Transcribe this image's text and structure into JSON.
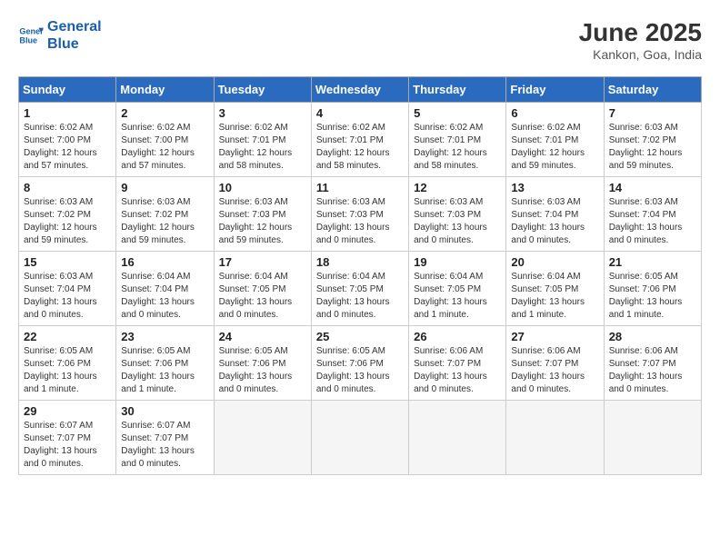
{
  "header": {
    "logo_line1": "General",
    "logo_line2": "Blue",
    "month": "June 2025",
    "location": "Kankon, Goa, India"
  },
  "days_of_week": [
    "Sunday",
    "Monday",
    "Tuesday",
    "Wednesday",
    "Thursday",
    "Friday",
    "Saturday"
  ],
  "weeks": [
    [
      {
        "day": "1",
        "info": "Sunrise: 6:02 AM\nSunset: 7:00 PM\nDaylight: 12 hours\nand 57 minutes."
      },
      {
        "day": "2",
        "info": "Sunrise: 6:02 AM\nSunset: 7:00 PM\nDaylight: 12 hours\nand 57 minutes."
      },
      {
        "day": "3",
        "info": "Sunrise: 6:02 AM\nSunset: 7:01 PM\nDaylight: 12 hours\nand 58 minutes."
      },
      {
        "day": "4",
        "info": "Sunrise: 6:02 AM\nSunset: 7:01 PM\nDaylight: 12 hours\nand 58 minutes."
      },
      {
        "day": "5",
        "info": "Sunrise: 6:02 AM\nSunset: 7:01 PM\nDaylight: 12 hours\nand 58 minutes."
      },
      {
        "day": "6",
        "info": "Sunrise: 6:02 AM\nSunset: 7:01 PM\nDaylight: 12 hours\nand 59 minutes."
      },
      {
        "day": "7",
        "info": "Sunrise: 6:03 AM\nSunset: 7:02 PM\nDaylight: 12 hours\nand 59 minutes."
      }
    ],
    [
      {
        "day": "8",
        "info": "Sunrise: 6:03 AM\nSunset: 7:02 PM\nDaylight: 12 hours\nand 59 minutes."
      },
      {
        "day": "9",
        "info": "Sunrise: 6:03 AM\nSunset: 7:02 PM\nDaylight: 12 hours\nand 59 minutes."
      },
      {
        "day": "10",
        "info": "Sunrise: 6:03 AM\nSunset: 7:03 PM\nDaylight: 12 hours\nand 59 minutes."
      },
      {
        "day": "11",
        "info": "Sunrise: 6:03 AM\nSunset: 7:03 PM\nDaylight: 13 hours\nand 0 minutes."
      },
      {
        "day": "12",
        "info": "Sunrise: 6:03 AM\nSunset: 7:03 PM\nDaylight: 13 hours\nand 0 minutes."
      },
      {
        "day": "13",
        "info": "Sunrise: 6:03 AM\nSunset: 7:04 PM\nDaylight: 13 hours\nand 0 minutes."
      },
      {
        "day": "14",
        "info": "Sunrise: 6:03 AM\nSunset: 7:04 PM\nDaylight: 13 hours\nand 0 minutes."
      }
    ],
    [
      {
        "day": "15",
        "info": "Sunrise: 6:03 AM\nSunset: 7:04 PM\nDaylight: 13 hours\nand 0 minutes."
      },
      {
        "day": "16",
        "info": "Sunrise: 6:04 AM\nSunset: 7:04 PM\nDaylight: 13 hours\nand 0 minutes."
      },
      {
        "day": "17",
        "info": "Sunrise: 6:04 AM\nSunset: 7:05 PM\nDaylight: 13 hours\nand 0 minutes."
      },
      {
        "day": "18",
        "info": "Sunrise: 6:04 AM\nSunset: 7:05 PM\nDaylight: 13 hours\nand 0 minutes."
      },
      {
        "day": "19",
        "info": "Sunrise: 6:04 AM\nSunset: 7:05 PM\nDaylight: 13 hours\nand 1 minute."
      },
      {
        "day": "20",
        "info": "Sunrise: 6:04 AM\nSunset: 7:05 PM\nDaylight: 13 hours\nand 1 minute."
      },
      {
        "day": "21",
        "info": "Sunrise: 6:05 AM\nSunset: 7:06 PM\nDaylight: 13 hours\nand 1 minute."
      }
    ],
    [
      {
        "day": "22",
        "info": "Sunrise: 6:05 AM\nSunset: 7:06 PM\nDaylight: 13 hours\nand 1 minute."
      },
      {
        "day": "23",
        "info": "Sunrise: 6:05 AM\nSunset: 7:06 PM\nDaylight: 13 hours\nand 1 minute."
      },
      {
        "day": "24",
        "info": "Sunrise: 6:05 AM\nSunset: 7:06 PM\nDaylight: 13 hours\nand 0 minutes."
      },
      {
        "day": "25",
        "info": "Sunrise: 6:05 AM\nSunset: 7:06 PM\nDaylight: 13 hours\nand 0 minutes."
      },
      {
        "day": "26",
        "info": "Sunrise: 6:06 AM\nSunset: 7:07 PM\nDaylight: 13 hours\nand 0 minutes."
      },
      {
        "day": "27",
        "info": "Sunrise: 6:06 AM\nSunset: 7:07 PM\nDaylight: 13 hours\nand 0 minutes."
      },
      {
        "day": "28",
        "info": "Sunrise: 6:06 AM\nSunset: 7:07 PM\nDaylight: 13 hours\nand 0 minutes."
      }
    ],
    [
      {
        "day": "29",
        "info": "Sunrise: 6:07 AM\nSunset: 7:07 PM\nDaylight: 13 hours\nand 0 minutes."
      },
      {
        "day": "30",
        "info": "Sunrise: 6:07 AM\nSunset: 7:07 PM\nDaylight: 13 hours\nand 0 minutes."
      },
      {
        "day": "",
        "info": ""
      },
      {
        "day": "",
        "info": ""
      },
      {
        "day": "",
        "info": ""
      },
      {
        "day": "",
        "info": ""
      },
      {
        "day": "",
        "info": ""
      }
    ]
  ]
}
